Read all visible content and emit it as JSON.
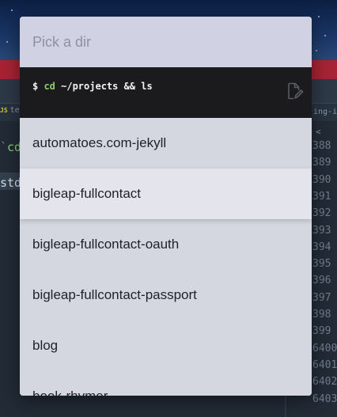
{
  "background": {
    "tab_left_badge": "JS",
    "tab_left_text": "te",
    "tab_right_text": "ing-in",
    "code_line_1_prefix": "`",
    "code_line_1": "cd",
    "code_line_2": "std",
    "gutter_chevron": "<",
    "line_numbers": [
      "388",
      "389",
      "390",
      "391",
      "392",
      "393",
      "394",
      "395",
      "396",
      "397",
      "398",
      "399",
      "6400",
      "6401",
      "6402",
      "6403"
    ]
  },
  "popup": {
    "prompt_placeholder": "Pick a dir",
    "command": {
      "prompt_char": "$ ",
      "name": "cd",
      "args": " ~/projects && ls"
    },
    "copy_icon": "edit-document-icon",
    "selected_index": 1,
    "items": [
      {
        "label": "automatoes.com-jekyll"
      },
      {
        "label": "bigleap-fullcontact"
      },
      {
        "label": "bigleap-fullcontact-oauth"
      },
      {
        "label": "bigleap-fullcontact-passport"
      },
      {
        "label": "blog"
      },
      {
        "label": "book-rhymer"
      }
    ]
  },
  "colors": {
    "popup_bg": "#d4d7df",
    "prompt_bg": "#d0d2e4",
    "terminal_bg": "#1b1b1d",
    "command_accent": "#8dcf64",
    "selected_bg": "#e4e5ec"
  }
}
